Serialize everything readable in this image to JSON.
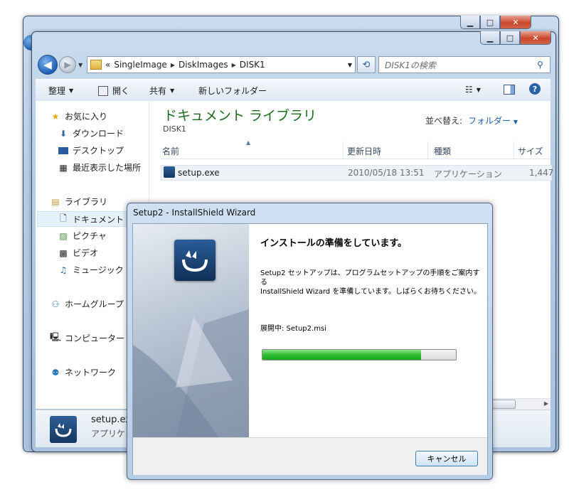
{
  "explorer": {
    "back_glyph": "◀",
    "forward_glyph": "▶",
    "address": {
      "prefix": "«",
      "segments": [
        "SingleImage",
        "DiskImages",
        "DISK1"
      ]
    },
    "search_placeholder": "DISK1の検索",
    "toolbar": {
      "organize": "整理",
      "open": "開く",
      "share": "共有",
      "new_folder": "新しいフォルダー"
    },
    "nav_pane": {
      "favorites": "お気に入り",
      "downloads": "ダウンロード",
      "desktop": "デスクトップ",
      "recent": "最近表示した場所",
      "libraries": "ライブラリ",
      "documents": "ドキュメント",
      "pictures": "ピクチャ",
      "videos": "ビデオ",
      "music": "ミュージック",
      "homegroup": "ホームグループ",
      "computer": "コンピューター",
      "network": "ネットワーク"
    },
    "library_title": "ドキュメント ライブラリ",
    "library_subtitle": "DISK1",
    "arrange_by_label": "並べ替え:",
    "arrange_by_value": "フォルダー",
    "columns": [
      "名前",
      "更新日時",
      "種類",
      "サイズ"
    ],
    "files": [
      {
        "name": "setup.exe",
        "modified": "2010/05/18 13:51",
        "type": "アプリケーション",
        "size": "1,447"
      }
    ],
    "details": {
      "name": "setup.ex",
      "type": "アプリケ"
    }
  },
  "wizard": {
    "title": "Setup2 - InstallShield Wizard",
    "heading": "インストールの準備をしています。",
    "description_line1": "Setup2 セットアップは、プログラムセットアップの手順をご案内する",
    "description_line2": "InstallShield Wizard を準備しています。しばらくお待ちください。",
    "status": "展開中: Setup2.msi",
    "progress": 0.82,
    "cancel_label": "キャンセル"
  },
  "colors": {
    "library_title": "#1e6b1e",
    "progress_fill": "#2fbf2f",
    "close_button": "#c9462c"
  }
}
